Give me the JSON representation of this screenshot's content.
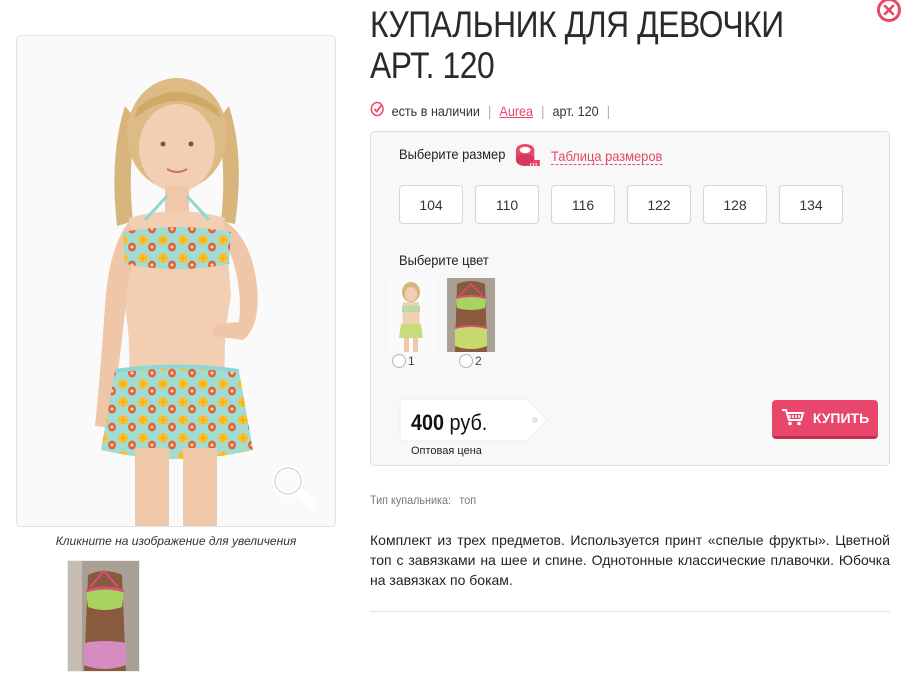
{
  "product": {
    "title": "КУПАЛЬНИК ДЛЯ ДЕВОЧКИ АРТ. 120",
    "availability": "есть в наличии",
    "brand": "Aurea",
    "article": "арт. 120"
  },
  "gallery": {
    "caption": "Кликните на изображение для увеличения"
  },
  "options": {
    "size_label": "Выберите размер",
    "size_table_link": "Таблица размеров",
    "sizes": [
      "104",
      "110",
      "116",
      "122",
      "128",
      "134"
    ],
    "color_label": "Выберите цвет",
    "colors": [
      {
        "label": "1"
      },
      {
        "label": "2"
      }
    ]
  },
  "price": {
    "amount": "400",
    "currency": "руб.",
    "type": "Оптовая цена"
  },
  "buy_button": {
    "label": "КУПИТЬ"
  },
  "attributes": [
    {
      "name": "Тип купальника:",
      "value": "топ"
    }
  ],
  "description": "Комплект из трех предметов. Используется принт «спелые фрукты». Цветной топ с завязками на шее и спине. Однотонные классические плавочки. Юбочка на завязках по бокам.",
  "colors": {
    "accent": "#e8466a",
    "panel_bg": "#f8f8f8"
  }
}
